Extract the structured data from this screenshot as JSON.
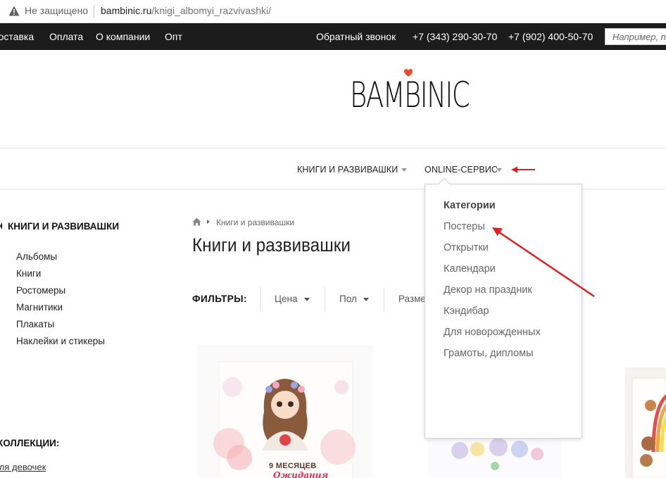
{
  "browser": {
    "security_label": "Не защищено",
    "url_host": "bambinic.ru",
    "url_path": "/knigi_albomyi_razvivashki/"
  },
  "topnav": {
    "links": [
      "Доставка",
      "Оплата",
      "О компании",
      "Опт"
    ],
    "callback": "Обратный звонок",
    "phone1": "+7 (343) 290-30-70",
    "phone2": "+7 (902) 400-50-70",
    "search_placeholder": "Например, постер"
  },
  "logo": {
    "text": "BAMBINIC"
  },
  "mainnav": {
    "books": "КНИГИ И РАЗВИВАШКИ",
    "online": "ONLINE-СЕРВИС"
  },
  "dropdown": {
    "heading": "Категории",
    "items": [
      "Постеры",
      "Открытки",
      "Календари",
      "Декор на праздник",
      "Кэндибар",
      "Для новорожденных",
      "Грамоты, дипломы"
    ]
  },
  "sidebar": {
    "heading": "КНИГИ И РАЗВИВАШКИ",
    "items": [
      "Альбомы",
      "Книги",
      "Ростомеры",
      "Магнитики",
      "Плакаты",
      "Наклейки и стикеры"
    ],
    "collections_heading": "КОЛЛЕКЦИИ:",
    "collection_link": "Для девочек"
  },
  "breadcrumb": {
    "current": "Книги и развивашки"
  },
  "page_title": "Книги и развивашки",
  "filters": {
    "label": "ФИЛЬТРЫ:",
    "price": "Цена",
    "gender": "Пол",
    "size": "Размер"
  },
  "products": {
    "book1_title": "9 МЕСЯЦЕВ",
    "book1_subtitle": "Ожидания"
  },
  "colors": {
    "topnav_bg": "#1c1c1c",
    "accent_red": "#e02020",
    "heart": "#f04a2a"
  }
}
